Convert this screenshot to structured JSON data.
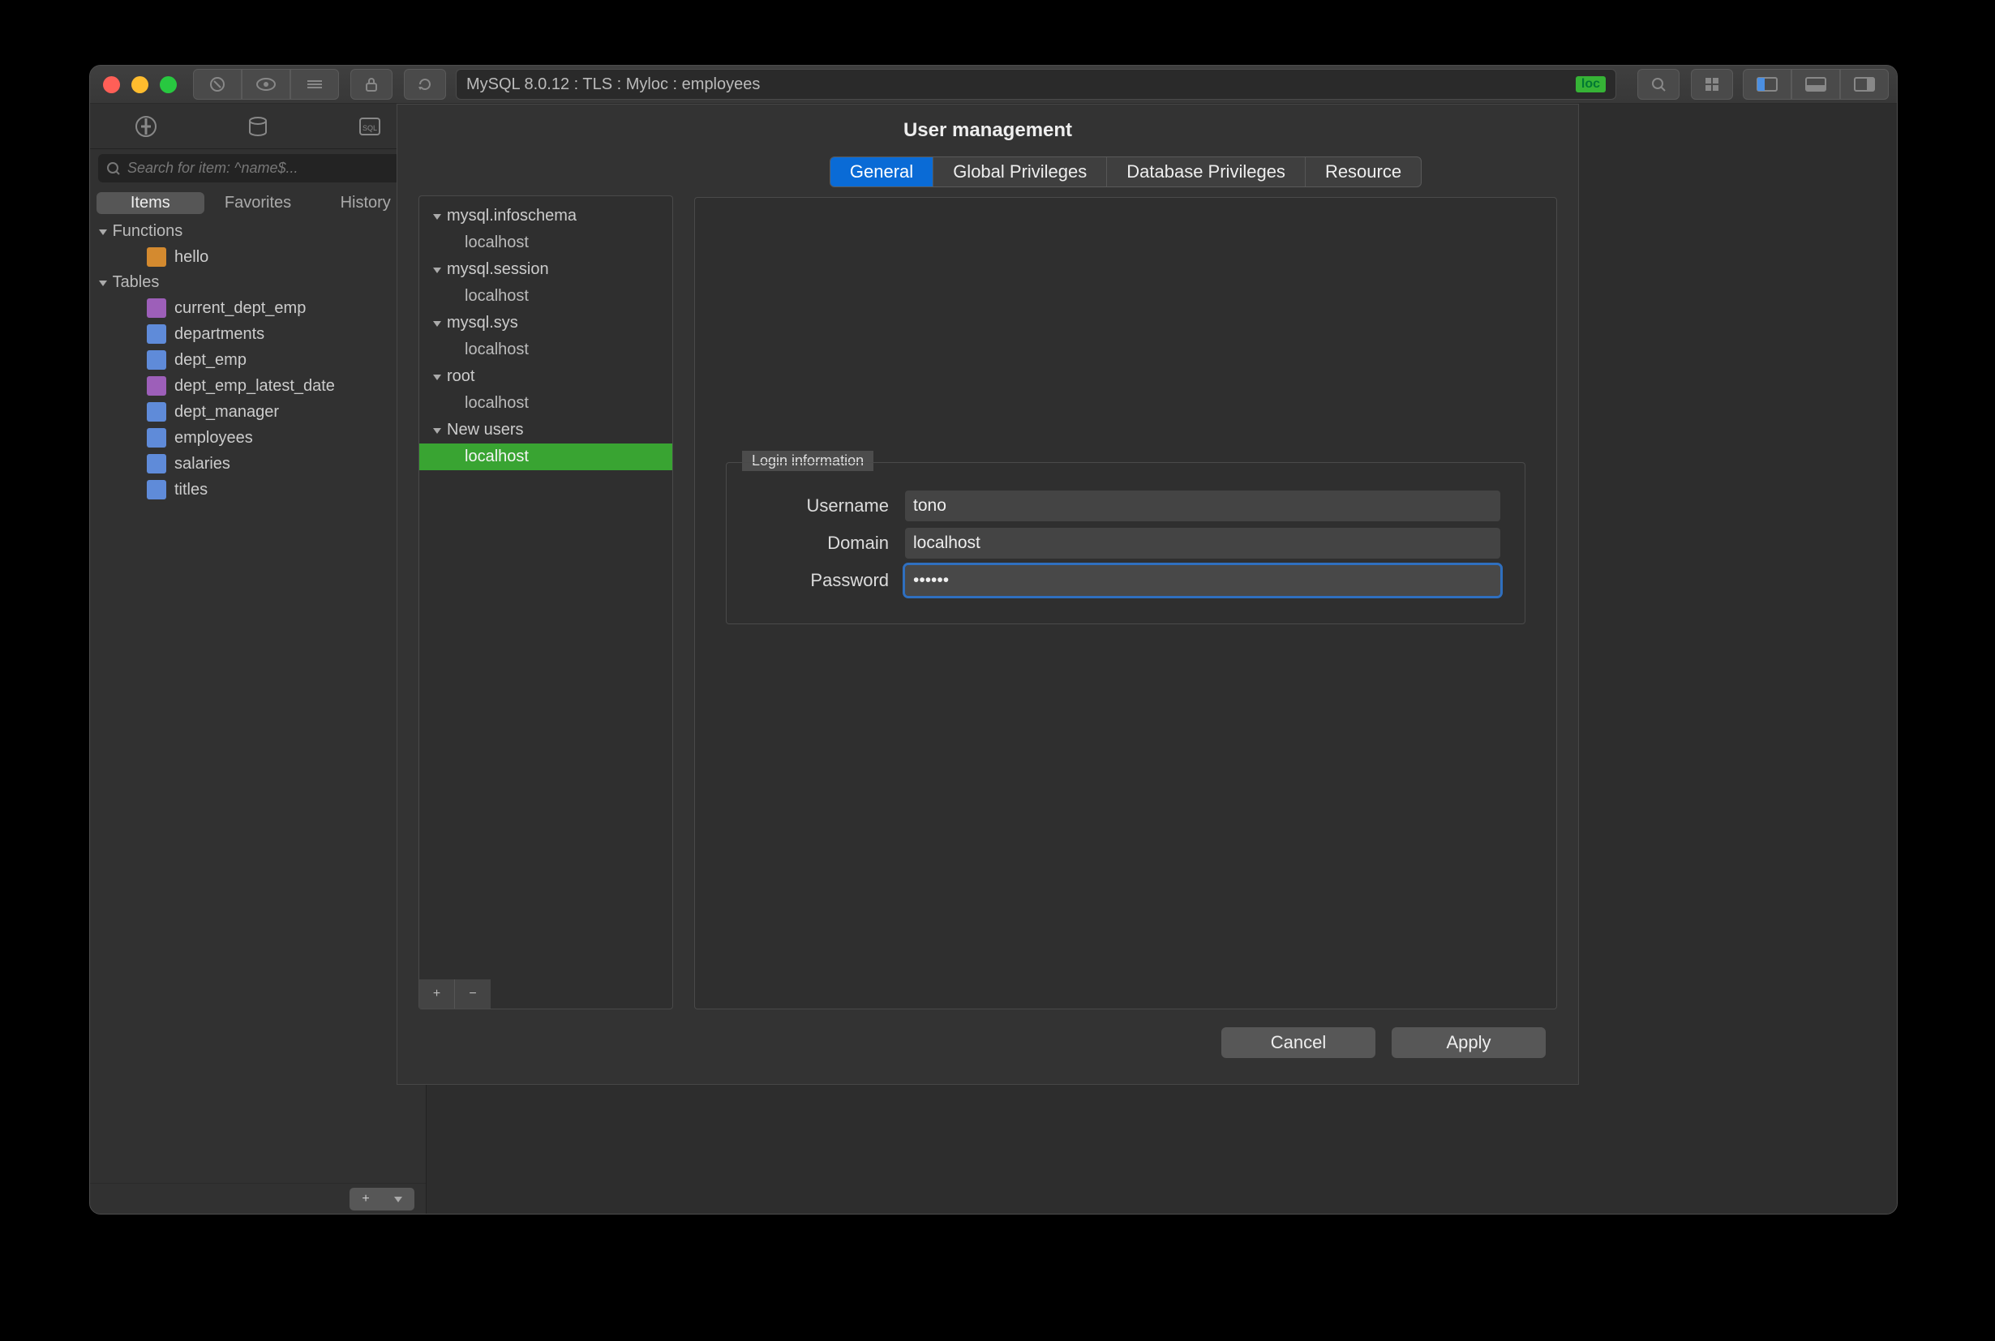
{
  "connection_string": "MySQL 8.0.12 : TLS : Myloc : employees",
  "loc_badge": "loc",
  "search_placeholder": "Search for item: ^name$...",
  "sidebar_subtabs": [
    "Items",
    "Favorites",
    "History"
  ],
  "tree": {
    "functions": {
      "label": "Functions",
      "items": [
        {
          "name": "hello",
          "icon": "fn"
        }
      ]
    },
    "tables": {
      "label": "Tables",
      "items": [
        {
          "name": "current_dept_emp",
          "icon": "view"
        },
        {
          "name": "departments",
          "icon": "table"
        },
        {
          "name": "dept_emp",
          "icon": "table"
        },
        {
          "name": "dept_emp_latest_date",
          "icon": "view"
        },
        {
          "name": "dept_manager",
          "icon": "table"
        },
        {
          "name": "employees",
          "icon": "table"
        },
        {
          "name": "salaries",
          "icon": "table"
        },
        {
          "name": "titles",
          "icon": "table"
        }
      ]
    }
  },
  "dialog": {
    "title": "User management",
    "tabs": [
      "General",
      "Global Privileges",
      "Database Privileges",
      "Resource"
    ],
    "active_tab": 0,
    "user_groups": [
      {
        "name": "mysql.infoschema",
        "hosts": [
          "localhost"
        ]
      },
      {
        "name": "mysql.session",
        "hosts": [
          "localhost"
        ]
      },
      {
        "name": "mysql.sys",
        "hosts": [
          "localhost"
        ]
      },
      {
        "name": "root",
        "hosts": [
          "localhost"
        ]
      },
      {
        "name": "New users",
        "hosts": [
          "localhost"
        ],
        "new": true
      }
    ],
    "selected": "New users/localhost",
    "form": {
      "legend": "Login information",
      "fields": {
        "username": {
          "label": "Username",
          "value": "tono"
        },
        "domain": {
          "label": "Domain",
          "value": "localhost"
        },
        "password": {
          "label": "Password",
          "value": "••••••"
        }
      }
    },
    "buttons": {
      "cancel": "Cancel",
      "apply": "Apply"
    }
  }
}
